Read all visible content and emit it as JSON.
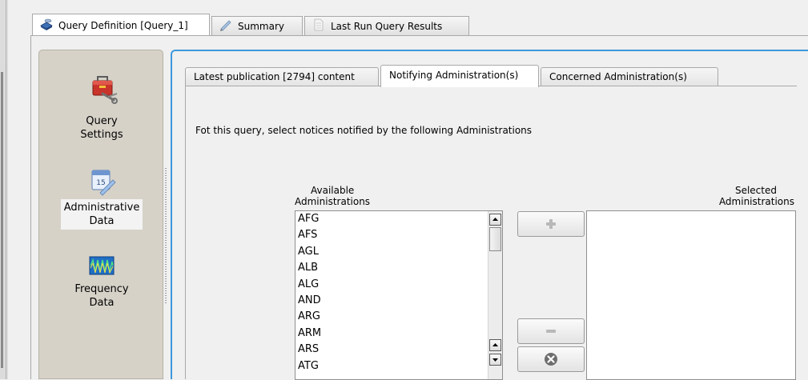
{
  "top_tabs": [
    {
      "label": "Query Definition [Query_1]",
      "icon": "database-icon",
      "active": true
    },
    {
      "label": "Summary",
      "icon": "pencil-icon",
      "active": false
    },
    {
      "label": "Last Run Query Results",
      "icon": "document-icon",
      "active": false
    }
  ],
  "sidebar": {
    "items": [
      {
        "label_line1": "Query",
        "label_line2": "Settings",
        "icon": "toolbox-icon",
        "selected": false
      },
      {
        "label_line1": "Administrative",
        "label_line2": "Data",
        "icon": "calendar-icon",
        "selected": true
      },
      {
        "label_line1": "Frequency",
        "label_line2": "Data",
        "icon": "frequency-waveform-icon",
        "selected": false
      }
    ]
  },
  "sub_tabs": [
    {
      "label": "Latest publication [2794] content",
      "active": false
    },
    {
      "label": "Notifying Administration(s)",
      "active": true
    },
    {
      "label": "Concerned Administration(s)",
      "active": false
    }
  ],
  "instruction": "Fot this query, select notices notified by the following Administrations",
  "available": {
    "header_line1": "Available",
    "header_line2": "Administrations",
    "items": [
      "AFG",
      "AFS",
      "AGL",
      "ALB",
      "ALG",
      "AND",
      "ARG",
      "ARM",
      "ARS",
      "ATG"
    ]
  },
  "selected": {
    "header_line1": "Selected",
    "header_line2": "Administrations",
    "items": []
  },
  "buttons": {
    "add_icon": "plus-icon",
    "remove_icon": "minus-icon",
    "clear_icon": "clear-x-icon"
  }
}
